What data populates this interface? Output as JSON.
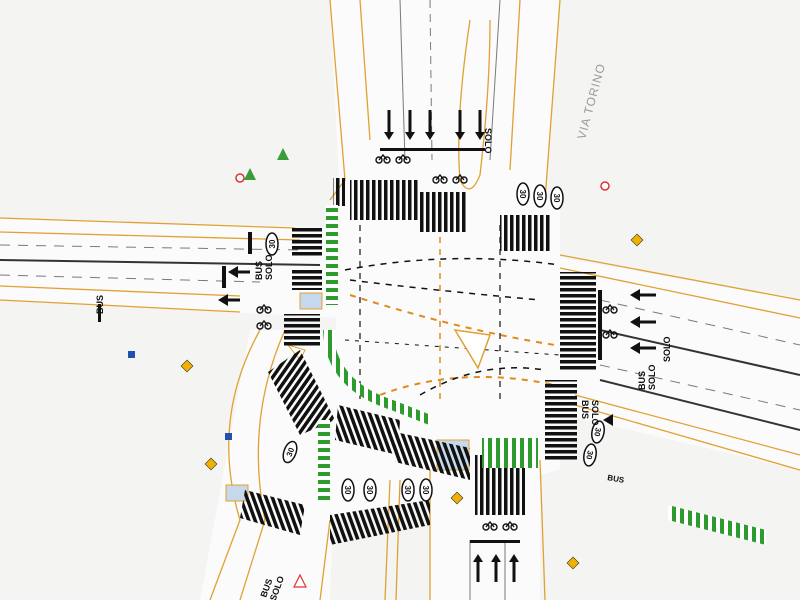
{
  "plan": {
    "street_label": "VIA TORINO",
    "markings": {
      "bus": "BUS",
      "solo": "SOLO",
      "speed": "30"
    },
    "colors": {
      "background": "#f4f4f2",
      "road": "#fbfbfb",
      "edge": "#e0a133",
      "lane_line": "#7a7a7a",
      "crossing": "#111111",
      "cycle": "#2e9b2e",
      "guide_dash": "#e08a1e",
      "island": "#c6d9ec"
    },
    "icons": [
      "arrow-straight-icon",
      "arrow-left-icon",
      "arrow-right-icon",
      "bicycle-icon",
      "speed-limit-icon",
      "traffic-sign-icon"
    ]
  }
}
